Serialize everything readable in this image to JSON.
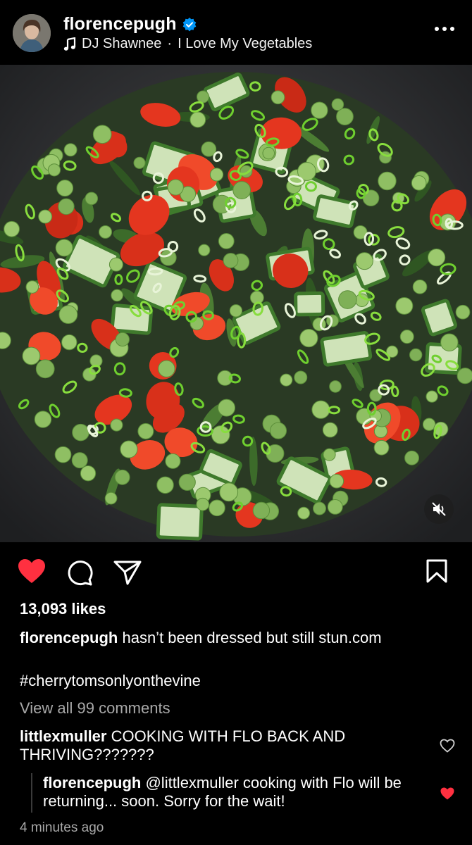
{
  "post": {
    "username": "florencepugh",
    "verified": true,
    "audio_artist": "DJ Shawnee",
    "audio_separator": "·",
    "audio_title": "I Love My Vegetables",
    "more_icon": "more-horizontal-icon"
  },
  "media": {
    "description_icon": "salad-photo",
    "mute_icon": "speaker-muted-icon"
  },
  "actions": {
    "like_icon": "heart-filled-icon",
    "comment_icon": "comment-icon",
    "share_icon": "send-icon",
    "save_icon": "bookmark-icon",
    "like_color": "#ff3040"
  },
  "likes_text": "13,093 likes",
  "caption": {
    "username": "florencepugh",
    "text": "hasn’t been dressed but still stun.com"
  },
  "hashtag": "#cherrytomsonlyonthevine",
  "view_comments": "View all 99 comments",
  "comments": [
    {
      "username": "littlexmuller",
      "text": "COOKING WITH FLO BACK AND THRIVING???????",
      "liked": false
    }
  ],
  "reply": {
    "username": "florencepugh",
    "text": "@littlexmuller cooking with Flo will be returning... soon. Sorry for the wait!",
    "liked": true
  },
  "timestamp": "4 minutes ago"
}
